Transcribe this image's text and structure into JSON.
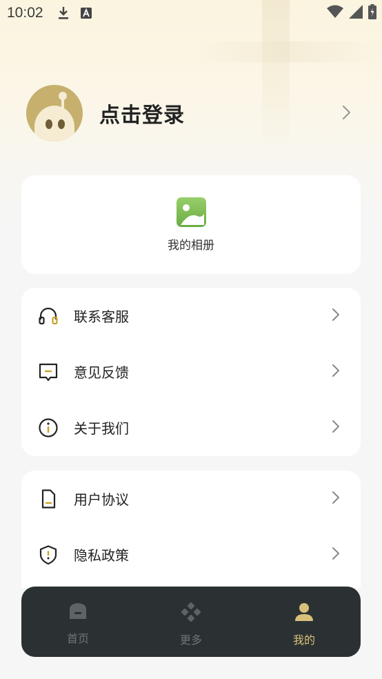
{
  "status_bar": {
    "time": "10:02",
    "icons": [
      "download-icon",
      "a-notification-icon",
      "wifi-icon",
      "signal-icon",
      "battery-icon"
    ]
  },
  "profile": {
    "login_label": "点击登录"
  },
  "album": {
    "label": "我的相册"
  },
  "menu_group_1": [
    {
      "label": "联系客服",
      "icon": "headset-icon"
    },
    {
      "label": "意见反馈",
      "icon": "feedback-icon"
    },
    {
      "label": "关于我们",
      "icon": "info-icon"
    }
  ],
  "menu_group_2": [
    {
      "label": "用户协议",
      "icon": "document-icon"
    },
    {
      "label": "隐私政策",
      "icon": "shield-icon"
    }
  ],
  "bottom_nav": {
    "items": [
      {
        "label": "首页",
        "icon": "home-icon",
        "active": false
      },
      {
        "label": "更多",
        "icon": "more-icon",
        "active": false
      },
      {
        "label": "我的",
        "icon": "user-icon",
        "active": true
      }
    ]
  },
  "colors": {
    "accent": "#d9c07a",
    "icon_accent": "#c9a227",
    "nav_background": "#2b3133",
    "card_background": "#ffffff"
  }
}
